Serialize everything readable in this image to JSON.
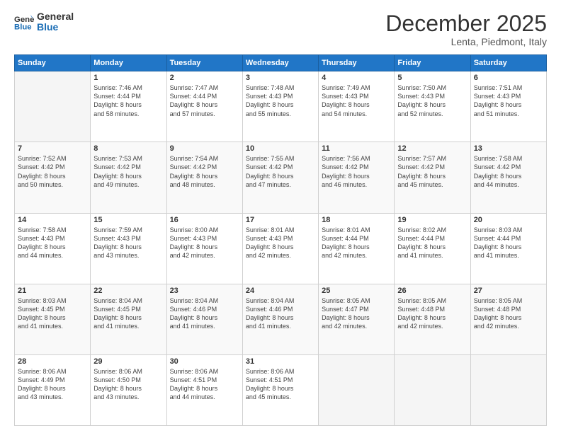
{
  "header": {
    "logo_line1": "General",
    "logo_line2": "Blue",
    "month": "December 2025",
    "location": "Lenta, Piedmont, Italy"
  },
  "weekdays": [
    "Sunday",
    "Monday",
    "Tuesday",
    "Wednesday",
    "Thursday",
    "Friday",
    "Saturday"
  ],
  "weeks": [
    [
      {
        "day": "",
        "info": ""
      },
      {
        "day": "1",
        "info": "Sunrise: 7:46 AM\nSunset: 4:44 PM\nDaylight: 8 hours\nand 58 minutes."
      },
      {
        "day": "2",
        "info": "Sunrise: 7:47 AM\nSunset: 4:44 PM\nDaylight: 8 hours\nand 57 minutes."
      },
      {
        "day": "3",
        "info": "Sunrise: 7:48 AM\nSunset: 4:43 PM\nDaylight: 8 hours\nand 55 minutes."
      },
      {
        "day": "4",
        "info": "Sunrise: 7:49 AM\nSunset: 4:43 PM\nDaylight: 8 hours\nand 54 minutes."
      },
      {
        "day": "5",
        "info": "Sunrise: 7:50 AM\nSunset: 4:43 PM\nDaylight: 8 hours\nand 52 minutes."
      },
      {
        "day": "6",
        "info": "Sunrise: 7:51 AM\nSunset: 4:43 PM\nDaylight: 8 hours\nand 51 minutes."
      }
    ],
    [
      {
        "day": "7",
        "info": "Sunrise: 7:52 AM\nSunset: 4:42 PM\nDaylight: 8 hours\nand 50 minutes."
      },
      {
        "day": "8",
        "info": "Sunrise: 7:53 AM\nSunset: 4:42 PM\nDaylight: 8 hours\nand 49 minutes."
      },
      {
        "day": "9",
        "info": "Sunrise: 7:54 AM\nSunset: 4:42 PM\nDaylight: 8 hours\nand 48 minutes."
      },
      {
        "day": "10",
        "info": "Sunrise: 7:55 AM\nSunset: 4:42 PM\nDaylight: 8 hours\nand 47 minutes."
      },
      {
        "day": "11",
        "info": "Sunrise: 7:56 AM\nSunset: 4:42 PM\nDaylight: 8 hours\nand 46 minutes."
      },
      {
        "day": "12",
        "info": "Sunrise: 7:57 AM\nSunset: 4:42 PM\nDaylight: 8 hours\nand 45 minutes."
      },
      {
        "day": "13",
        "info": "Sunrise: 7:58 AM\nSunset: 4:42 PM\nDaylight: 8 hours\nand 44 minutes."
      }
    ],
    [
      {
        "day": "14",
        "info": "Sunrise: 7:58 AM\nSunset: 4:43 PM\nDaylight: 8 hours\nand 44 minutes."
      },
      {
        "day": "15",
        "info": "Sunrise: 7:59 AM\nSunset: 4:43 PM\nDaylight: 8 hours\nand 43 minutes."
      },
      {
        "day": "16",
        "info": "Sunrise: 8:00 AM\nSunset: 4:43 PM\nDaylight: 8 hours\nand 42 minutes."
      },
      {
        "day": "17",
        "info": "Sunrise: 8:01 AM\nSunset: 4:43 PM\nDaylight: 8 hours\nand 42 minutes."
      },
      {
        "day": "18",
        "info": "Sunrise: 8:01 AM\nSunset: 4:44 PM\nDaylight: 8 hours\nand 42 minutes."
      },
      {
        "day": "19",
        "info": "Sunrise: 8:02 AM\nSunset: 4:44 PM\nDaylight: 8 hours\nand 41 minutes."
      },
      {
        "day": "20",
        "info": "Sunrise: 8:03 AM\nSunset: 4:44 PM\nDaylight: 8 hours\nand 41 minutes."
      }
    ],
    [
      {
        "day": "21",
        "info": "Sunrise: 8:03 AM\nSunset: 4:45 PM\nDaylight: 8 hours\nand 41 minutes."
      },
      {
        "day": "22",
        "info": "Sunrise: 8:04 AM\nSunset: 4:45 PM\nDaylight: 8 hours\nand 41 minutes."
      },
      {
        "day": "23",
        "info": "Sunrise: 8:04 AM\nSunset: 4:46 PM\nDaylight: 8 hours\nand 41 minutes."
      },
      {
        "day": "24",
        "info": "Sunrise: 8:04 AM\nSunset: 4:46 PM\nDaylight: 8 hours\nand 41 minutes."
      },
      {
        "day": "25",
        "info": "Sunrise: 8:05 AM\nSunset: 4:47 PM\nDaylight: 8 hours\nand 42 minutes."
      },
      {
        "day": "26",
        "info": "Sunrise: 8:05 AM\nSunset: 4:48 PM\nDaylight: 8 hours\nand 42 minutes."
      },
      {
        "day": "27",
        "info": "Sunrise: 8:05 AM\nSunset: 4:48 PM\nDaylight: 8 hours\nand 42 minutes."
      }
    ],
    [
      {
        "day": "28",
        "info": "Sunrise: 8:06 AM\nSunset: 4:49 PM\nDaylight: 8 hours\nand 43 minutes."
      },
      {
        "day": "29",
        "info": "Sunrise: 8:06 AM\nSunset: 4:50 PM\nDaylight: 8 hours\nand 43 minutes."
      },
      {
        "day": "30",
        "info": "Sunrise: 8:06 AM\nSunset: 4:51 PM\nDaylight: 8 hours\nand 44 minutes."
      },
      {
        "day": "31",
        "info": "Sunrise: 8:06 AM\nSunset: 4:51 PM\nDaylight: 8 hours\nand 45 minutes."
      },
      {
        "day": "",
        "info": ""
      },
      {
        "day": "",
        "info": ""
      },
      {
        "day": "",
        "info": ""
      }
    ]
  ]
}
